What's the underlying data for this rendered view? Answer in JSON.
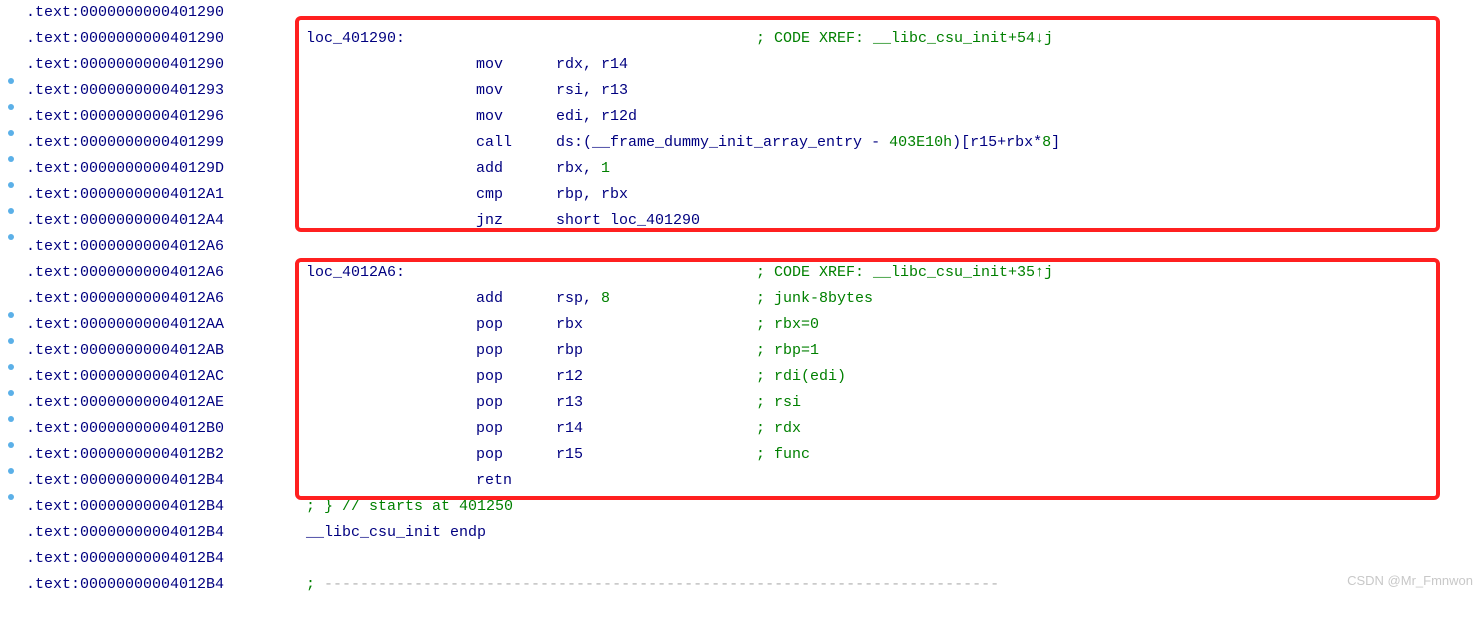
{
  "watermark": "CSDN @Mr_Fmnwon",
  "lines": [
    {
      "dot": false,
      "addr": ".text:0000000000401290",
      "label": "",
      "mn": "",
      "op": "",
      "cmt": ""
    },
    {
      "dot": false,
      "addr": ".text:0000000000401290",
      "label": "loc_401290:",
      "mn": "",
      "op": "",
      "cmt": "; CODE XREF: __libc_csu_init+54↓j"
    },
    {
      "dot": true,
      "addr": ".text:0000000000401290",
      "label": "",
      "mn": "mov",
      "op": "rdx, r14",
      "cmt": ""
    },
    {
      "dot": true,
      "addr": ".text:0000000000401293",
      "label": "",
      "mn": "mov",
      "op": "rsi, r13",
      "cmt": ""
    },
    {
      "dot": true,
      "addr": ".text:0000000000401296",
      "label": "",
      "mn": "mov",
      "op": "edi, r12d",
      "cmt": ""
    },
    {
      "dot": true,
      "addr": ".text:0000000000401299",
      "label": "",
      "mn": "call",
      "op_html": "ds:(<span class='ident'>__frame_dummy_init_array_entry</span> - <span class='number'>403E10h</span>)[r15+rbx*<span class='number'>8</span>]",
      "cmt": ""
    },
    {
      "dot": true,
      "addr": ".text:000000000040129D",
      "label": "",
      "mn": "add",
      "op_html": "rbx, <span class='number'>1</span>",
      "cmt": ""
    },
    {
      "dot": true,
      "addr": ".text:00000000004012A1",
      "label": "",
      "mn": "cmp",
      "op": "rbp, rbx",
      "cmt": ""
    },
    {
      "dot": true,
      "addr": ".text:00000000004012A4",
      "label": "",
      "mn": "jnz",
      "op_html": "short <span class='label'>loc_401290</span>",
      "cmt": ""
    },
    {
      "dot": false,
      "addr": ".text:00000000004012A6",
      "label": "",
      "mn": "",
      "op": "",
      "cmt": ""
    },
    {
      "dot": false,
      "addr": ".text:00000000004012A6",
      "label": "loc_4012A6:",
      "mn": "",
      "op": "",
      "cmt": "; CODE XREF: __libc_csu_init+35↑j"
    },
    {
      "dot": true,
      "addr": ".text:00000000004012A6",
      "label": "",
      "mn": "add",
      "op_html": "rsp, <span class='number'>8</span>",
      "cmt": "; junk-8bytes"
    },
    {
      "dot": true,
      "addr": ".text:00000000004012AA",
      "label": "",
      "mn": "pop",
      "op": "rbx",
      "cmt": "; rbx=0"
    },
    {
      "dot": true,
      "addr": ".text:00000000004012AB",
      "label": "",
      "mn": "pop",
      "op": "rbp",
      "cmt": "; rbp=1"
    },
    {
      "dot": true,
      "addr": ".text:00000000004012AC",
      "label": "",
      "mn": "pop",
      "op": "r12",
      "cmt": "; rdi(edi)"
    },
    {
      "dot": true,
      "addr": ".text:00000000004012AE",
      "label": "",
      "mn": "pop",
      "op": "r13",
      "cmt": "; rsi"
    },
    {
      "dot": true,
      "addr": ".text:00000000004012B0",
      "label": "",
      "mn": "pop",
      "op": "r14",
      "cmt": "; rdx"
    },
    {
      "dot": true,
      "addr": ".text:00000000004012B2",
      "label": "",
      "mn": "pop",
      "op": "r15",
      "cmt": "; func"
    },
    {
      "dot": true,
      "addr": ".text:00000000004012B4",
      "label": "",
      "mn": "retn",
      "op": "",
      "cmt": ""
    },
    {
      "dot": false,
      "addr": ".text:00000000004012B4",
      "raw_html": "<span class='comment'>; } // starts at 401250</span>"
    },
    {
      "dot": false,
      "addr": ".text:00000000004012B4",
      "raw_html": "<span class='ident'>__libc_csu_init</span> <span class='keyword'>endp</span>"
    },
    {
      "dot": false,
      "addr": ".text:00000000004012B4",
      "label": "",
      "mn": "",
      "op": "",
      "cmt": ""
    },
    {
      "dot": false,
      "addr": ".text:00000000004012B4",
      "raw_html": "<span class='comment'>; </span><span class='dash'>---------------------------------------------------------------------------</span>"
    }
  ]
}
